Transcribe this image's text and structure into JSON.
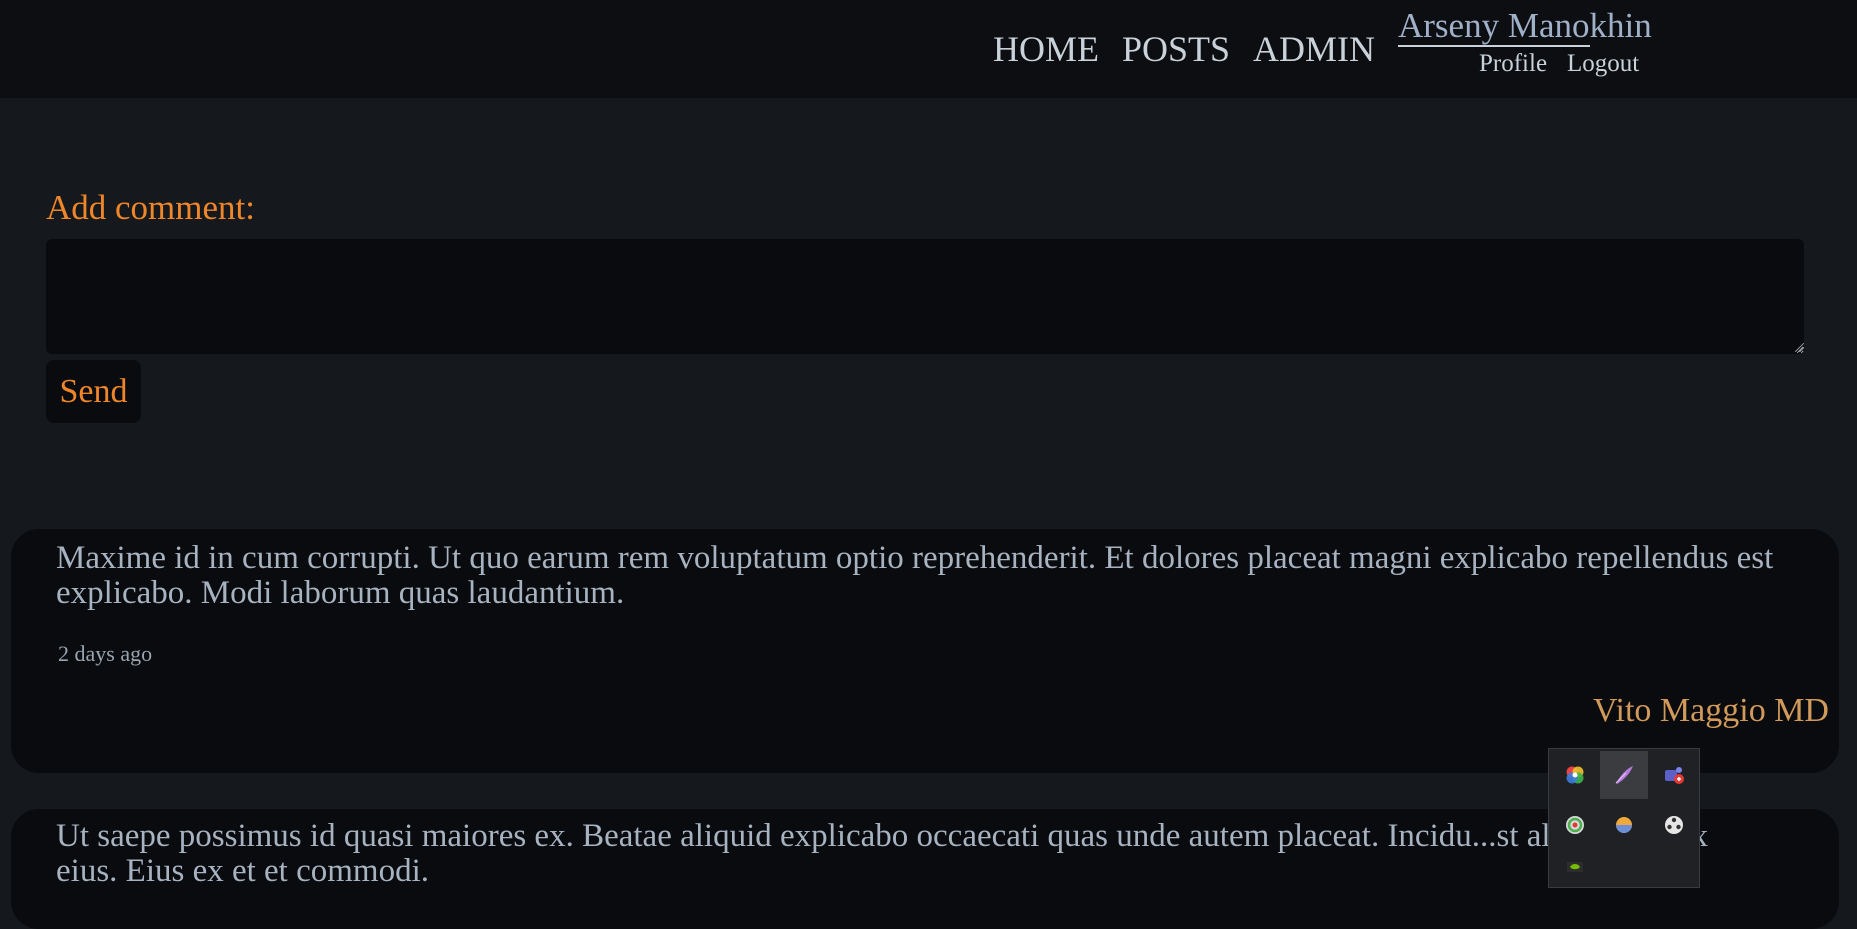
{
  "nav": {
    "home": "HOME",
    "posts": "POSTS",
    "admin": "ADMIN"
  },
  "user": {
    "name": "Arseny Manokhin",
    "profile": "Profile",
    "logout": "Logout"
  },
  "comment_form": {
    "label": "Add comment:",
    "value": "",
    "send_label": "Send"
  },
  "comments": [
    {
      "text": "Maxime id in cum corrupti. Ut quo earum rem voluptatum optio reprehenderit. Et dolores placeat magni explicabo repellendus est explicabo. Modi laborum quas laudantium.",
      "time": "2 days ago",
      "author": "Vito Maggio MD"
    },
    {
      "text": "Ut saepe possimus id quasi maiores ex. Beatae aliquid explicabo occaecati quas unde autem placeat. Incidu...st alias saepe ex eius. Eius ex et et commodi."
    }
  ],
  "tray_icons": [
    "color-wheel-icon",
    "feather-pen-icon",
    "teams-notification-icon",
    "disc-icon",
    "weather-icon",
    "film-reel-icon",
    "nvidia-icon"
  ],
  "colors": {
    "accent": "#f0862a",
    "author": "#d19a5a",
    "page_bg": "#15181c",
    "card_bg": "#090b0e",
    "header_bg": "#0c0e11"
  }
}
